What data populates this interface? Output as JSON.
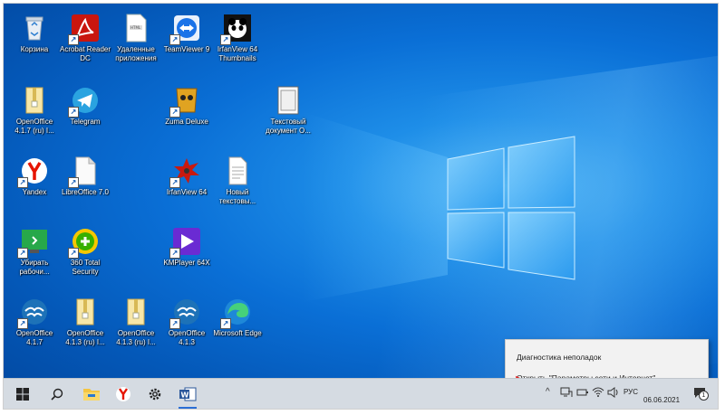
{
  "desktop": {
    "icons": [
      {
        "id": "recycle",
        "label": "Корзина"
      },
      {
        "id": "acrobat",
        "label": "Acrobat Reader DC"
      },
      {
        "id": "remote-apps",
        "label": "Удаленные приложения"
      },
      {
        "id": "teamviewer",
        "label": "TeamViewer 9"
      },
      {
        "id": "irfan-thumbs",
        "label": "IrfanView 64 Thumbnails"
      },
      {
        "id": "openoffice-1",
        "label": "OpenOffice 4.1.7 (ru) I..."
      },
      {
        "id": "telegram",
        "label": "Telegram"
      },
      {
        "id": "zuma",
        "label": "Zuma Deluxe"
      },
      {
        "id": "text-doc-1",
        "label": "Текстовый документ О..."
      },
      {
        "id": "yandex",
        "label": "Yandex"
      },
      {
        "id": "libreoffice",
        "label": "LibreOffice 7.0"
      },
      {
        "id": "irfanview",
        "label": "IrfanView 64"
      },
      {
        "id": "new-text",
        "label": "Новый текстовы..."
      },
      {
        "id": "cleanup",
        "label": "Убирать рабочи..."
      },
      {
        "id": "360-security",
        "label": "360 Total Security"
      },
      {
        "id": "kmplayer",
        "label": "KMPlayer 64X"
      },
      {
        "id": "openoffice-2",
        "label": "OpenOffice 4.1.7"
      },
      {
        "id": "openoffice-3",
        "label": "OpenOffice 4.1.3 (ru) I..."
      },
      {
        "id": "openoffice-4",
        "label": "OpenOffice 4.1.3 (ru) I..."
      },
      {
        "id": "openoffice-5",
        "label": "OpenOffice 4.1.3"
      },
      {
        "id": "edge",
        "label": "Microsoft Edge"
      }
    ]
  },
  "context_menu": {
    "items": [
      {
        "label": "Диагностика неполадок"
      },
      {
        "label": "Открыть \"Параметры сети и Интернет\""
      }
    ]
  },
  "taskbar": {
    "icons": [
      "windows-start-icon",
      "search-icon",
      "file-explorer-icon",
      "yandex-browser-icon",
      "settings-gear-icon",
      "word-icon"
    ],
    "tray": {
      "language": "РУС",
      "date": "06.06.2021",
      "notification_count": "1"
    }
  },
  "colors": {
    "desktop_blue": "#0a6fd6",
    "taskbar_bg": "#d5dbe2",
    "annotation_red": "#e02020"
  }
}
